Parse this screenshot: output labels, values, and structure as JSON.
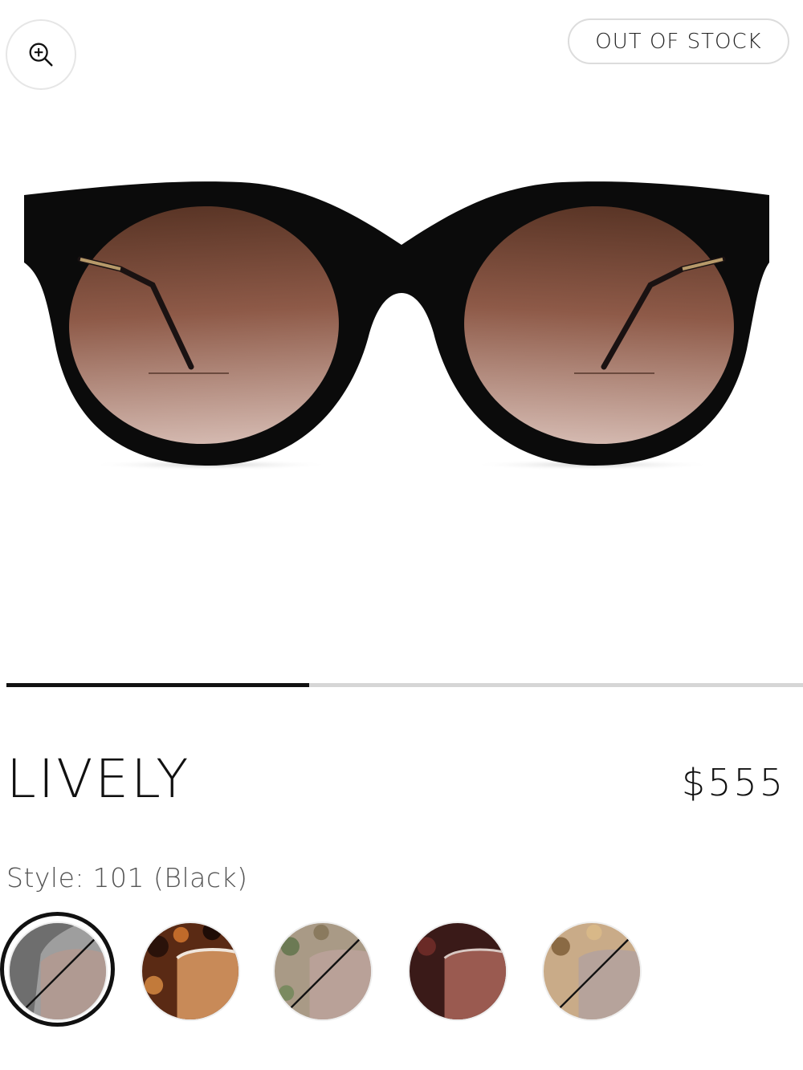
{
  "badge": {
    "label": "OUT OF STOCK"
  },
  "zoom": {
    "icon": "zoom-in-icon"
  },
  "gallery": {
    "progress": 0.38
  },
  "product": {
    "name": "LIVELY",
    "price": "$555",
    "style_label": "Style:",
    "style_value": "101 (Black)"
  },
  "swatches": [
    {
      "code": "101",
      "color": "Black",
      "available": false,
      "selected": true
    },
    {
      "code": "",
      "color": "Tortoise",
      "available": true,
      "selected": false
    },
    {
      "code": "",
      "color": "Green Tortoise",
      "available": false,
      "selected": false
    },
    {
      "code": "",
      "color": "Dark Red",
      "available": true,
      "selected": false
    },
    {
      "code": "",
      "color": "Honey Tortoise",
      "available": false,
      "selected": false
    }
  ],
  "colors": {
    "text": "#111111",
    "muted": "#555555",
    "track": "#d6d6d6",
    "lens_top": "#5a3526",
    "lens_bottom": "#c9aaa0"
  }
}
